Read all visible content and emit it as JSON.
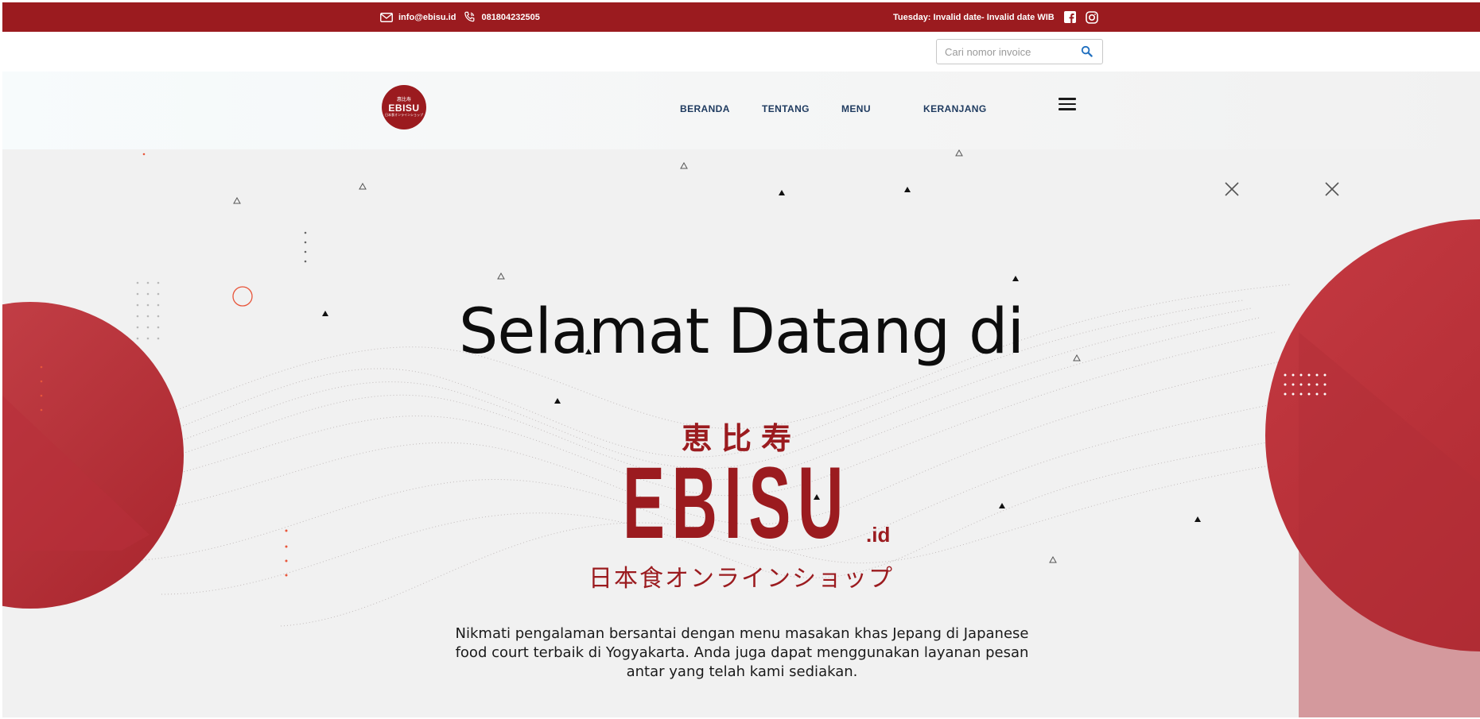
{
  "topbar": {
    "email": "info@ebisu.id",
    "phone": "081804232505",
    "datetime": "Tuesday: Invalid date- Invalid date WIB",
    "icons": [
      "mail-icon",
      "phone-icon",
      "facebook-icon",
      "instagram-icon"
    ]
  },
  "search": {
    "placeholder": "Cari nomor invoice",
    "value": "",
    "icon": "search-icon"
  },
  "nav": {
    "logo": {
      "kanji": "惠比寿",
      "name": "EBISU",
      "sub": "日本食オンラインショップ"
    },
    "items": [
      "BERANDA",
      "TENTANG",
      "MENU",
      "KERANJANG"
    ],
    "menu_icon": "hamburger-icon"
  },
  "hero": {
    "title": "Selamat Datang di",
    "brand_kanji": "恵比寿",
    "brand_name": "EBISU",
    "brand_tld": ".id",
    "brand_sub": "日本食オンラインショップ",
    "description": "Nikmati pengalaman bersantai dengan menu masakan khas Jepang di Japanese food court terbaik di Yogyakarta. Anda juga dapat menggunakan layanan pesan antar yang telah kami sediakan."
  },
  "colors": {
    "brand_red": "#9b1b1f",
    "shape_red": "#c1343c",
    "nav_text": "#1e3a5f",
    "accent_orange": "#e8553a"
  }
}
